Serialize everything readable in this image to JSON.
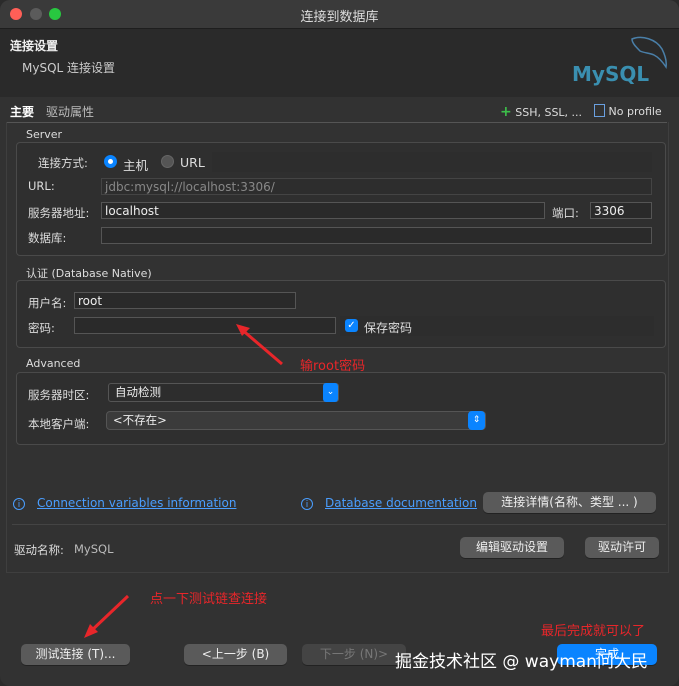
{
  "window": {
    "title": "连接到数据库"
  },
  "header": {
    "title": "连接设置",
    "subtitle": "MySQL 连接设置",
    "logo_text": "MySQL"
  },
  "tabs": {
    "main": "主要",
    "driver": "驱动属性",
    "ssh": "SSH, SSL, ...",
    "profile": "No profile"
  },
  "server": {
    "section": "Server",
    "conn_method_label": "连接方式:",
    "host_option": "主机",
    "url_option": "URL",
    "url_label": "URL:",
    "url_value": "jdbc:mysql://localhost:3306/",
    "host_label": "服务器地址:",
    "host_value": "localhost",
    "port_label": "端口:",
    "port_value": "3306",
    "db_label": "数据库:",
    "db_value": ""
  },
  "auth": {
    "section": "认证 (Database Native)",
    "user_label": "用户名:",
    "user_value": "root",
    "pwd_label": "密码:",
    "pwd_value": "",
    "save_pwd": "保存密码"
  },
  "advanced": {
    "section": "Advanced",
    "tz_label": "服务器时区:",
    "tz_value": "自动检测",
    "client_label": "本地客户端:",
    "client_value": "<不存在>"
  },
  "links": {
    "conn_vars": "Connection variables information",
    "db_doc": "Database documentation",
    "conn_detail_btn": "连接详情(名称、类型 ... )"
  },
  "driver": {
    "name_label": "驱动名称:",
    "name_value": "MySQL",
    "edit_btn": "编辑驱动设置",
    "license_btn": "驱动许可"
  },
  "footer": {
    "test_btn": "测试连接 (T)...",
    "prev_btn": "<上一步 (B)",
    "next_btn": "下一步 (N)>",
    "finish_btn": "完成"
  },
  "annotations": {
    "pwd_hint": "输root密码",
    "test_hint": "点一下测试链查连接",
    "finish_hint": "最后完成就可以了"
  },
  "watermark": "掘金技术社区 @ wayman问大民",
  "colors": {
    "accent": "#0a84ff",
    "annotation": "#e8262a",
    "link": "#4a9eff"
  }
}
